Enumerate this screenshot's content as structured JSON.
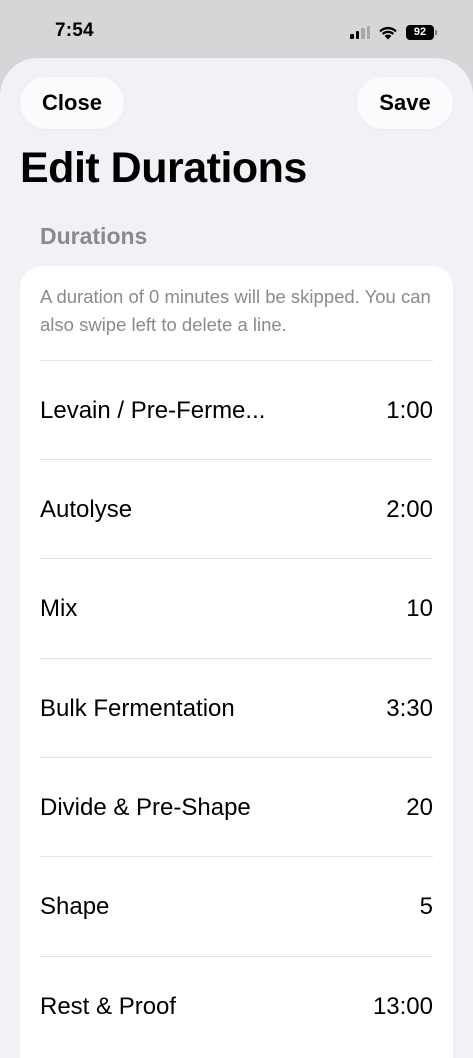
{
  "status_bar": {
    "time": "7:54",
    "battery": "92",
    "icons": [
      "signal-icon",
      "wifi-icon",
      "battery-icon"
    ]
  },
  "nav": {
    "close_label": "Close",
    "save_label": "Save"
  },
  "page": {
    "title": "Edit Durations",
    "section_header": "Durations",
    "footnote": "A duration of 0 minutes will be skipped. You can also swipe left to delete a line."
  },
  "durations": [
    {
      "label": "Levain / Pre-Ferme...",
      "value": "1:00"
    },
    {
      "label": "Autolyse",
      "value": "2:00"
    },
    {
      "label": "Mix",
      "value": "10"
    },
    {
      "label": "Bulk Fermentation",
      "value": "3:30"
    },
    {
      "label": "Divide & Pre-Shape",
      "value": "20"
    },
    {
      "label": "Shape",
      "value": "5"
    },
    {
      "label": "Rest & Proof",
      "value": "13:00"
    }
  ],
  "colors": {
    "backdrop": "#d6d6d8",
    "sheet": "#f2f1f6",
    "card": "#ffffff",
    "secondary_text": "#8a8a8e"
  }
}
